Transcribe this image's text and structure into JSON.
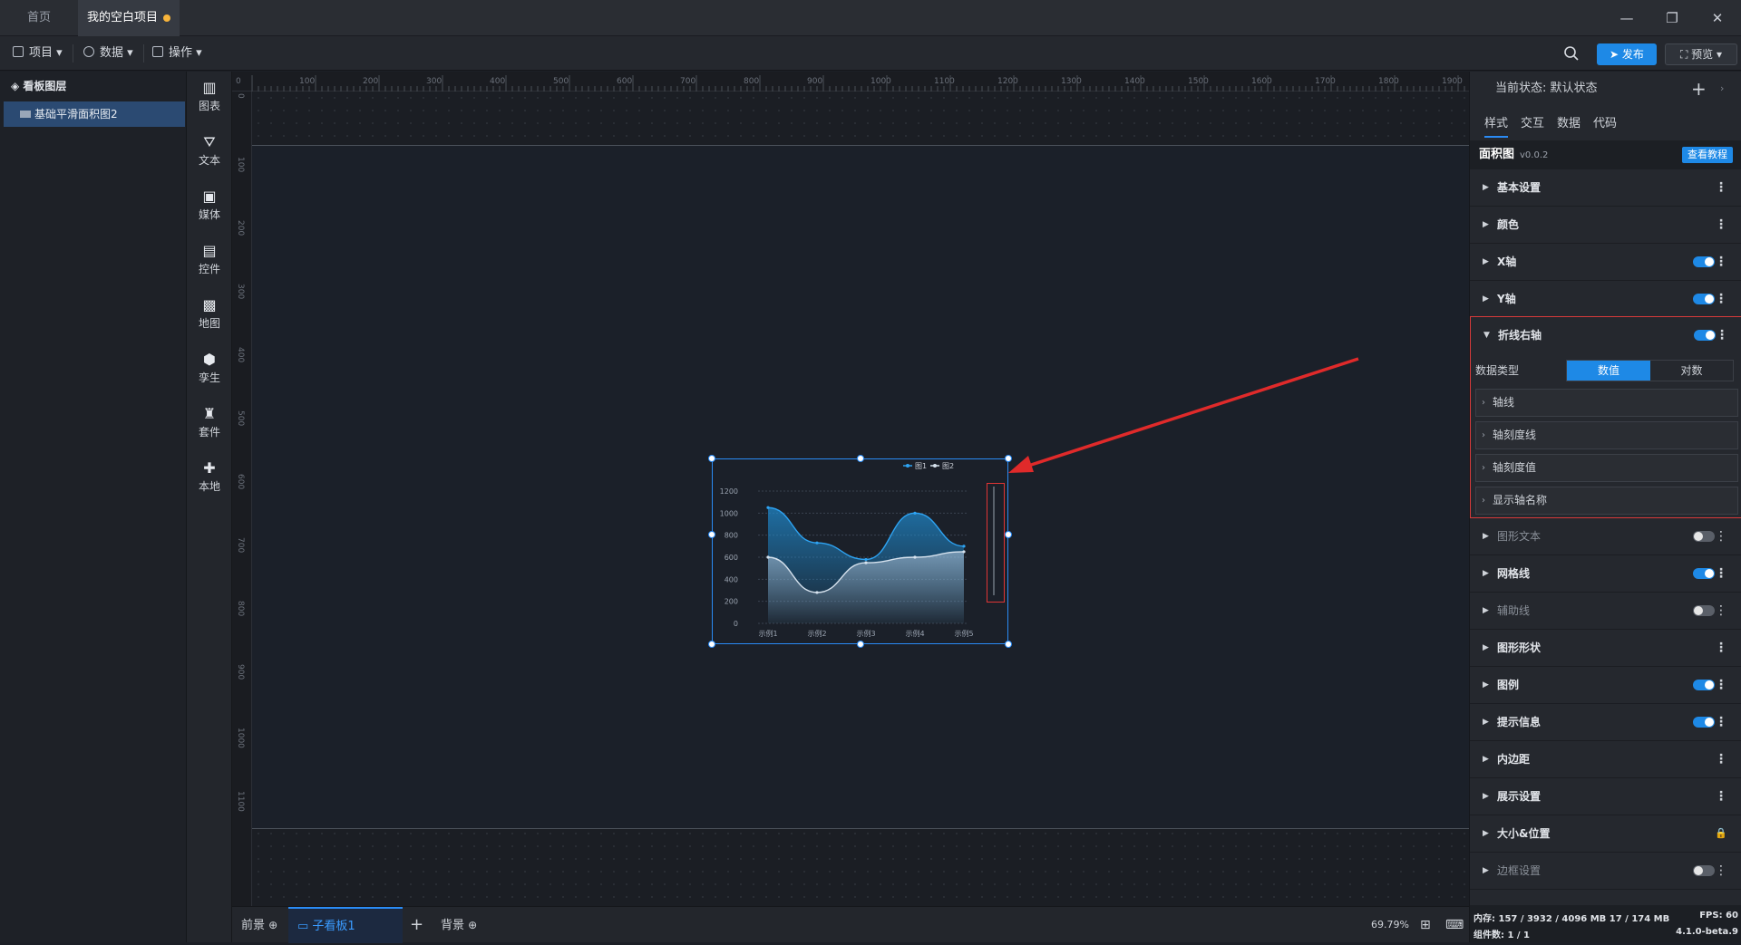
{
  "tabs": {
    "home": "首页",
    "project": "我的空白项目"
  },
  "toolbar": {
    "project": "项目",
    "data": "数据",
    "action": "操作",
    "publish": "发布",
    "preview": "预览"
  },
  "layers": {
    "title": "看板图层",
    "item": "基础平滑面积图2"
  },
  "components": [
    {
      "label": "图表",
      "icon": "bar-chart-icon"
    },
    {
      "label": "文本",
      "icon": "text-icon"
    },
    {
      "label": "媒体",
      "icon": "media-icon"
    },
    {
      "label": "控件",
      "icon": "control-icon"
    },
    {
      "label": "地图",
      "icon": "map-icon"
    },
    {
      "label": "孪生",
      "icon": "twin-icon"
    },
    {
      "label": "套件",
      "icon": "kit-icon"
    },
    {
      "label": "本地",
      "icon": "local-icon"
    }
  ],
  "ruler": {
    "h": [
      "0",
      "100",
      "200",
      "300",
      "400",
      "500",
      "600",
      "700",
      "800",
      "900",
      "1000",
      "1100",
      "1200",
      "1300",
      "1400",
      "1500",
      "1600",
      "1700",
      "1800",
      "1900"
    ],
    "v": [
      "0",
      "100",
      "200",
      "300",
      "400",
      "500",
      "600",
      "700",
      "800",
      "900",
      "1000",
      "1100"
    ]
  },
  "chart_data": {
    "type": "area",
    "categories": [
      "示例1",
      "示例2",
      "示例3",
      "示例4",
      "示例5"
    ],
    "series": [
      {
        "name": "图1",
        "values": [
          1050,
          730,
          580,
          1000,
          700
        ]
      },
      {
        "name": "图2",
        "values": [
          600,
          280,
          550,
          600,
          650
        ]
      }
    ],
    "y_ticks": [
      "0",
      "200",
      "400",
      "600",
      "800",
      "1000",
      "1200"
    ],
    "ylim": [
      0,
      1200
    ],
    "grid": true,
    "legend": "top-right"
  },
  "bottom": {
    "front": "前景",
    "subboard": "子看板1",
    "back": "背景",
    "zoom": "69.79%"
  },
  "right": {
    "state_label": "当前状态:",
    "state_value": "默认状态",
    "tabs": [
      "样式",
      "交互",
      "数据",
      "代码"
    ],
    "component_name": "面积图",
    "version": "v0.0.2",
    "tutorial": "查看教程",
    "sections_top": [
      "基本设置",
      "颜色",
      "X轴",
      "Y轴"
    ],
    "expanded_title": "折线右轴",
    "data_type_label": "数据类型",
    "data_type_options": [
      "数值",
      "对数"
    ],
    "subs": [
      "轴线",
      "轴刻度线",
      "轴刻度值",
      "显示轴名称"
    ],
    "sections_bottom": [
      "图形文本",
      "网格线",
      "辅助线",
      "图形形状",
      "图例",
      "提示信息",
      "内边距",
      "展示设置",
      "大小&位置",
      "边框设置"
    ],
    "memory_label": "内存:",
    "memory_value": "157 / 3932 / 4096 MB  17 / 174 MB",
    "fps_label": "FPS:",
    "fps_value": "60",
    "count_label": "组件数:",
    "count_value": "1 / 1",
    "version_app": "4.1.0-beta.9"
  }
}
